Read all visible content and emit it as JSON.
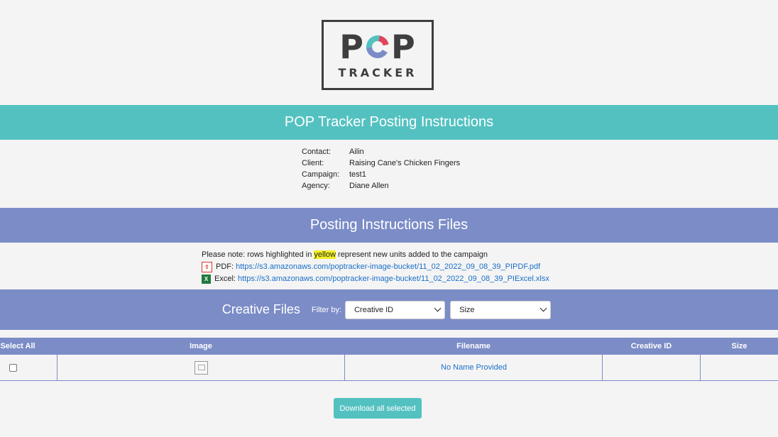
{
  "logo": {
    "top_text_p1": "P",
    "top_text_p2": "P",
    "sub_text": "TRACKER"
  },
  "header": {
    "title": "POP Tracker Posting Instructions"
  },
  "info": [
    {
      "label": "Contact:",
      "value": "Ailin"
    },
    {
      "label": "Client:",
      "value": "Raising Cane's Chicken Fingers"
    },
    {
      "label": "Campaign:",
      "value": "test1"
    },
    {
      "label": "Agency:",
      "value": "Diane Allen"
    }
  ],
  "files_section": {
    "title": "Posting Instructions Files",
    "note_before": "Please note: rows highlighted in ",
    "note_highlight": "yellow",
    "note_after": " represent new units added to the campaign",
    "pdf_label": "PDF:",
    "pdf_link": "https://s3.amazonaws.com/poptracker-image-bucket/11_02_2022_09_08_39_PIPDF.pdf",
    "excel_label": "Excel:",
    "excel_link": "https://s3.amazonaws.com/poptracker-image-bucket/11_02_2022_09_08_39_PIExcel.xlsx"
  },
  "creative": {
    "title": "Creative Files",
    "filter_label": "Filter by:",
    "filter_creative_id": "Creative ID",
    "filter_size": "Size"
  },
  "table": {
    "headers": [
      "Select All",
      "Image",
      "Filename",
      "Creative ID",
      "Size"
    ],
    "rows": [
      {
        "filename": "No Name Provided",
        "creative_id": "",
        "size": ""
      }
    ]
  },
  "download_button": "Download all selected",
  "colors": {
    "teal": "#54c1c1",
    "purple": "#7b8cc7",
    "link": "#1a6fc9",
    "highlight": "#f4f025"
  }
}
